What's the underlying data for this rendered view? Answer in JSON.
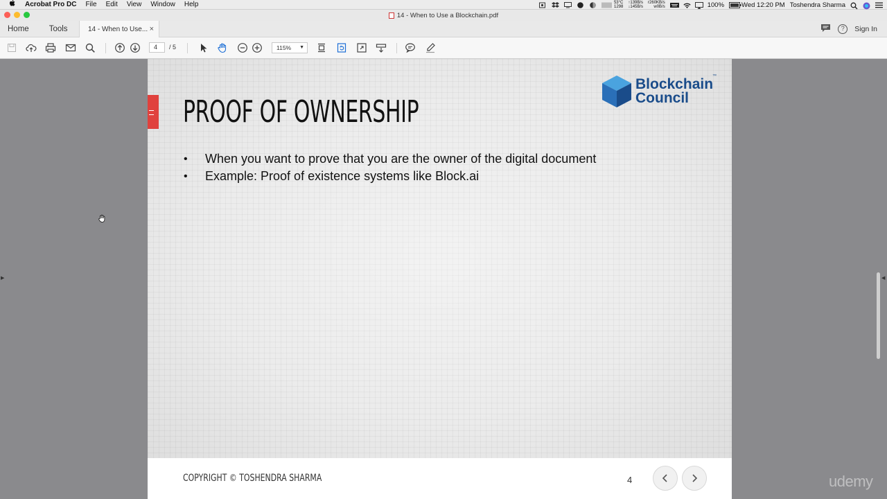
{
  "menubar": {
    "apple_icon": "apple-icon",
    "app_name": "Acrobat Pro DC",
    "items": [
      "File",
      "Edit",
      "View",
      "Window",
      "Help"
    ],
    "status": {
      "temp": "53°C",
      "temp2": "1298",
      "net_up": "↑139B/s",
      "net_down": "↓145B/s",
      "disk_r": "r260KB/s",
      "disk_w": "w0B/s",
      "battery": "100%",
      "datetime": "Wed 12:20 PM",
      "user": "Toshendra Sharma"
    }
  },
  "window": {
    "title": "14 - When to Use a Blockchain.pdf"
  },
  "tabs": {
    "home": "Home",
    "tools": "Tools",
    "document": "14 - When to Use...",
    "close": "×",
    "sign_in": "Sign In",
    "help_glyph": "?"
  },
  "toolbar": {
    "current_page": "4",
    "total_pages": "/ 5",
    "zoom": "115%"
  },
  "slide": {
    "title": "PROOF OF OWNERSHIP",
    "bullets": [
      "When you want to prove that you are the owner of the digital document",
      "Example: Proof of existence systems like Block.ai"
    ],
    "logo_line1": "Blockchain",
    "logo_line2": "Council",
    "logo_tm": "™",
    "copyright": "COPYRIGHT ©  TOSHENDRA SHARMA",
    "page_number": "4"
  },
  "watermark": "udemy",
  "colors": {
    "accent_red": "#e0413d",
    "brand_blue": "#1a4c8a",
    "cube_light": "#4aa3df"
  }
}
